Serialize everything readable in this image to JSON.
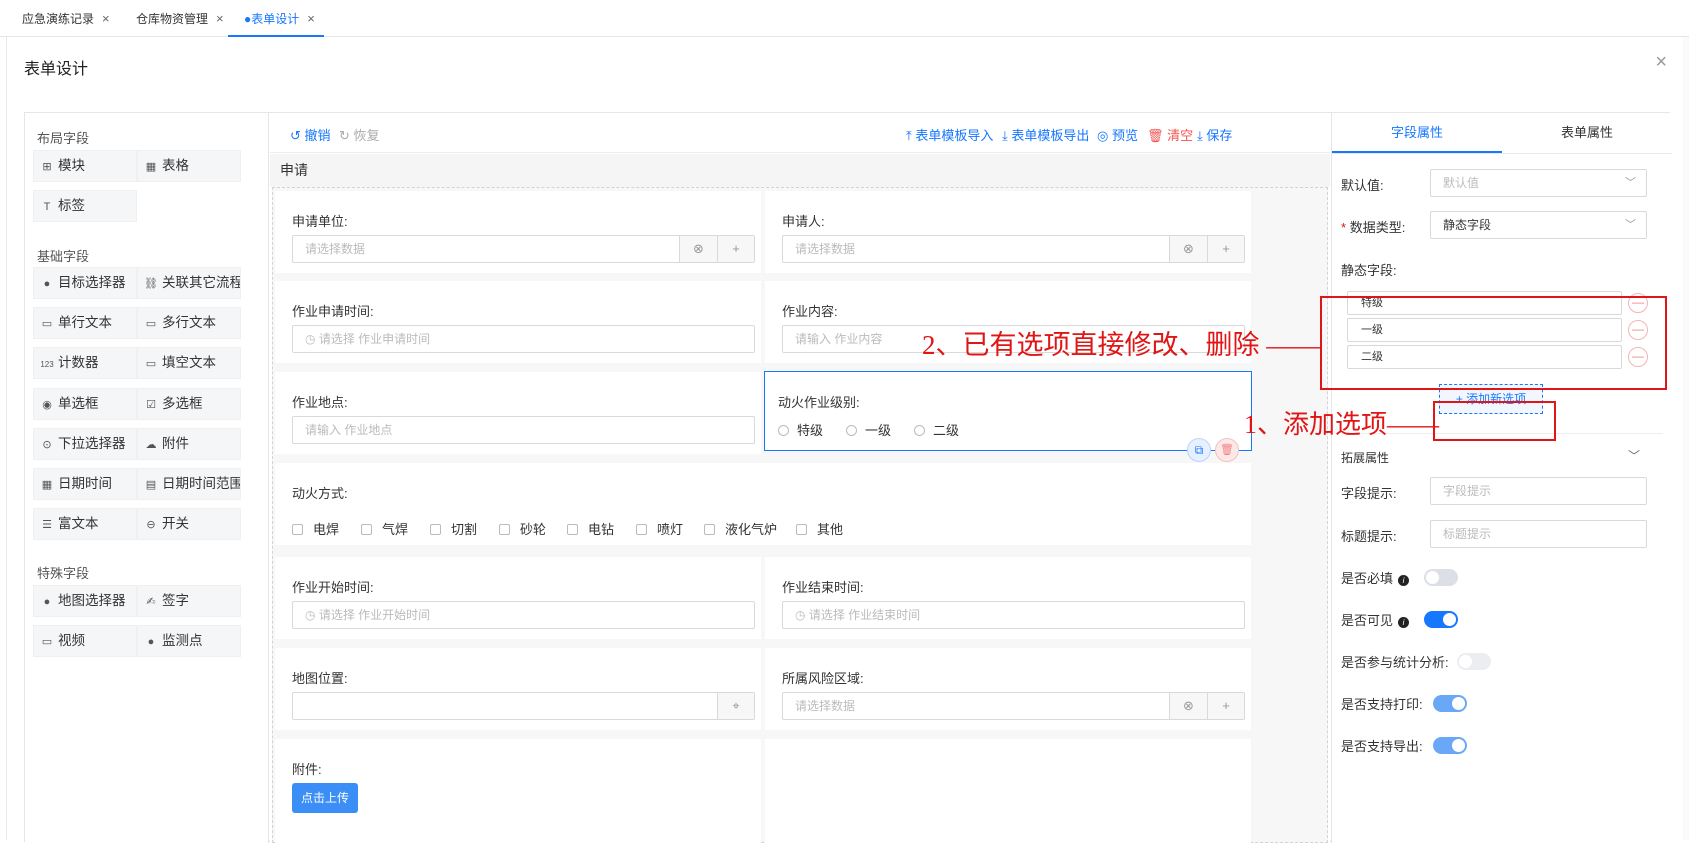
{
  "tabs": [
    {
      "label": "应急演练记录",
      "close": "×"
    },
    {
      "label": "仓库物资管理",
      "close": "×"
    },
    {
      "label": "●表单设计",
      "close": "×"
    }
  ],
  "page": {
    "title": "表单设计",
    "close": "×"
  },
  "left_panel": {
    "groups": [
      {
        "title": "布局字段",
        "items": [
          {
            "label": "模块",
            "icon": "⊞"
          },
          {
            "label": "表格",
            "icon": "▦"
          },
          {
            "label": "标签",
            "icon": "T"
          }
        ]
      },
      {
        "title": "基础字段",
        "items": [
          {
            "label": "目标选择器",
            "icon": "●"
          },
          {
            "label": "关联其它流程",
            "icon": "⛓"
          },
          {
            "label": "单行文本",
            "icon": "▭"
          },
          {
            "label": "多行文本",
            "icon": "▭"
          },
          {
            "label": "计数器",
            "icon": "123"
          },
          {
            "label": "填空文本",
            "icon": "▭"
          },
          {
            "label": "单选框",
            "icon": "◉"
          },
          {
            "label": "多选框",
            "icon": "☑"
          },
          {
            "label": "下拉选择器",
            "icon": "⊙"
          },
          {
            "label": "附件",
            "icon": "☁"
          },
          {
            "label": "日期时间",
            "icon": "▦"
          },
          {
            "label": "日期时间范围",
            "icon": "▤"
          },
          {
            "label": "富文本",
            "icon": "☰"
          },
          {
            "label": "开关",
            "icon": "⊖"
          }
        ]
      },
      {
        "title": "特殊字段",
        "items": [
          {
            "label": "地图选择器",
            "icon": "●"
          },
          {
            "label": "签字",
            "icon": "✍"
          },
          {
            "label": "视频",
            "icon": "▭"
          },
          {
            "label": "监测点",
            "icon": "●"
          }
        ]
      }
    ]
  },
  "toolbar": {
    "undo": "撤销",
    "redo": "恢复",
    "import": "表单模板导入",
    "export": "表单模板导出",
    "preview": "预览",
    "clear": "清空",
    "save": "保存"
  },
  "section": {
    "title": "申请"
  },
  "form": {
    "apply_unit": {
      "label": "申请单位:",
      "placeholder": "请选择数据"
    },
    "applicant": {
      "label": "申请人:",
      "placeholder": "请选择数据"
    },
    "apply_time": {
      "label": "作业申请时间:",
      "placeholder": "请选择 作业申请时间"
    },
    "content": {
      "label": "作业内容:",
      "placeholder": "请输入 作业内容"
    },
    "location": {
      "label": "作业地点:",
      "placeholder": "请输入 作业地点"
    },
    "fire_level": {
      "label": "动火作业级别:",
      "options": [
        "特级",
        "一级",
        "二级"
      ]
    },
    "fire_method": {
      "label": "动火方式:",
      "options": [
        "电焊",
        "气焊",
        "切割",
        "砂轮",
        "电钻",
        "喷灯",
        "液化气炉",
        "其他"
      ]
    },
    "start_time": {
      "label": "作业开始时间:",
      "placeholder": "请选择 作业开始时间"
    },
    "end_time": {
      "label": "作业结束时间:",
      "placeholder": "请选择 作业结束时间"
    },
    "map_location": {
      "label": "地图位置:",
      "placeholder": ""
    },
    "risk_area": {
      "label": "所属风险区域:",
      "placeholder": "请选择数据"
    },
    "attachment": {
      "label": "附件:",
      "button": "点击上传"
    }
  },
  "right_panel": {
    "tabs": [
      "字段属性",
      "表单属性"
    ],
    "default_value": {
      "label": "默认值:",
      "placeholder": "默认值"
    },
    "data_type": {
      "label": "数据类型:",
      "value": "静态字段",
      "required_mark": "*"
    },
    "static_fields": {
      "label": "静态字段:",
      "options": [
        "特级",
        "一级",
        "二级"
      ],
      "remove": "—"
    },
    "add_option": "+ 添加新选项",
    "ext_props": "拓展属性",
    "field_hint": {
      "label": "字段提示:",
      "placeholder": "字段提示"
    },
    "title_hint": {
      "label": "标题提示:",
      "placeholder": "标题提示"
    },
    "toggles": [
      {
        "label": "是否必填",
        "info": true,
        "on": false
      },
      {
        "label": "是否可见",
        "info": true,
        "on": true
      },
      {
        "label": "是否参与统计分析:",
        "info": false,
        "on": false
      },
      {
        "label": "是否支持打印:",
        "info": false,
        "on": true
      },
      {
        "label": "是否支持导出:",
        "info": false,
        "on": true
      }
    ]
  },
  "annotations": {
    "edit_note": "2、已有选项直接修改、删除 ——",
    "add_note": "1、添加选项——"
  },
  "colors": {
    "primary": "#1677ff",
    "danger": "#e01515",
    "toggle_on": "#1677ff",
    "toggle_on_light": "#6aa8f7"
  }
}
